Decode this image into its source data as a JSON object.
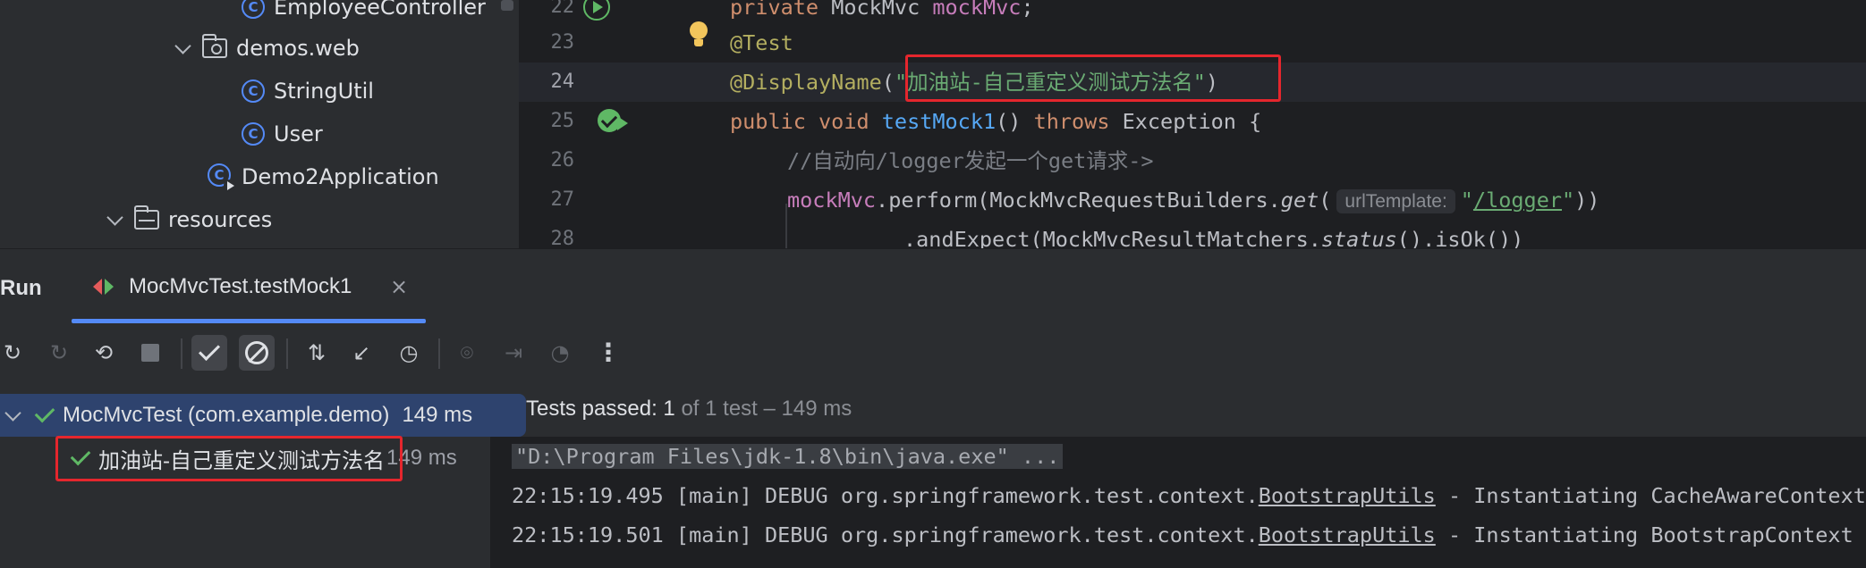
{
  "project_tree": {
    "items": [
      {
        "label": "EmployeeController",
        "type": "class"
      },
      {
        "label": "demos.web",
        "type": "package"
      },
      {
        "label": "StringUtil",
        "type": "class"
      },
      {
        "label": "User",
        "type": "class"
      },
      {
        "label": "Demo2Application",
        "type": "application"
      },
      {
        "label": "resources",
        "type": "resources-folder"
      }
    ]
  },
  "editor": {
    "lines": [
      {
        "num": "22",
        "code": "private MockMvc mockMvc;"
      },
      {
        "num": "23",
        "code": "@Test"
      },
      {
        "num": "24",
        "code": "@DisplayName(\"加油站-自己重定义测试方法名\")",
        "active": true
      },
      {
        "num": "25",
        "code": "public void testMock1() throws Exception {"
      },
      {
        "num": "26",
        "code": "//自动向/logger发起一个get请求->"
      },
      {
        "num": "27",
        "code": "mockMvc.perform(MockMvcRequestBuilders.get( urlTemplate: \"/logger\"))"
      },
      {
        "num": "28",
        "code": ".andExpect(MockMvcResultMatchers.status().isOk())"
      }
    ],
    "tokens": {
      "l22_kw": "private",
      "l22_type": " MockMvc ",
      "l22_field": "mockMvc",
      "l22_semi": ";",
      "l23_ann": "@Test",
      "l24_ann": "@DisplayName",
      "l24_open": "(",
      "l24_str": "\"加油站-自己重定义测试方法名\"",
      "l24_close": ")",
      "l25_kw1": "public",
      "l25_kw2": " void ",
      "l25_fn": "testMock1",
      "l25_parens": "() ",
      "l25_kw3": "throws",
      "l25_rest": " Exception {",
      "l26_comment": "//自动向/logger发起一个get请求->",
      "l27_field": "mockMvc",
      "l27_mid": ".perform(MockMvcRequestBuilders.",
      "l27_get": "get",
      "l27_open": "(",
      "l27_hint": "urlTemplate:",
      "l27_q1": "\"",
      "l27_path": "/logger",
      "l27_q2": "\"",
      "l27_close": "))",
      "l28_start": ".andExpect(MockMvcResultMatchers.",
      "l28_status": "status",
      "l28_end": "().isOk())"
    }
  },
  "run_panel": {
    "title": "Run",
    "tab_label": "MocMvcTest.testMock1",
    "tab_close": "×",
    "toolbar": {
      "more": "⋮"
    },
    "test_tree": {
      "suite_label": "MocMvcTest (com.example.demo)",
      "suite_duration": "149 ms",
      "test_label": "加油站-自己重定义测试方法名",
      "test_duration": "149 ms"
    },
    "summary": {
      "prefix": "Tests passed: ",
      "count": "1",
      "suffix": " of 1 test – 149 ms"
    },
    "console": {
      "command": "\"D:\\Program Files\\jdk-1.8\\bin\\java.exe\" ...",
      "log1_prefix": "22:15:19.495 [main] DEBUG org.springframework.test.context.",
      "log1_link": "BootstrapUtils",
      "log1_suffix": " - Instantiating CacheAwareContextLoaderDelegate",
      "log2_prefix": "22:15:19.501 [main] DEBUG org.springframework.test.context.",
      "log2_link": "BootstrapUtils",
      "log2_suffix": " - Instantiating BootstrapContext"
    }
  },
  "colors": {
    "highlight_box": "#e5262d",
    "accent": "#548af7",
    "success": "#5fb865"
  }
}
